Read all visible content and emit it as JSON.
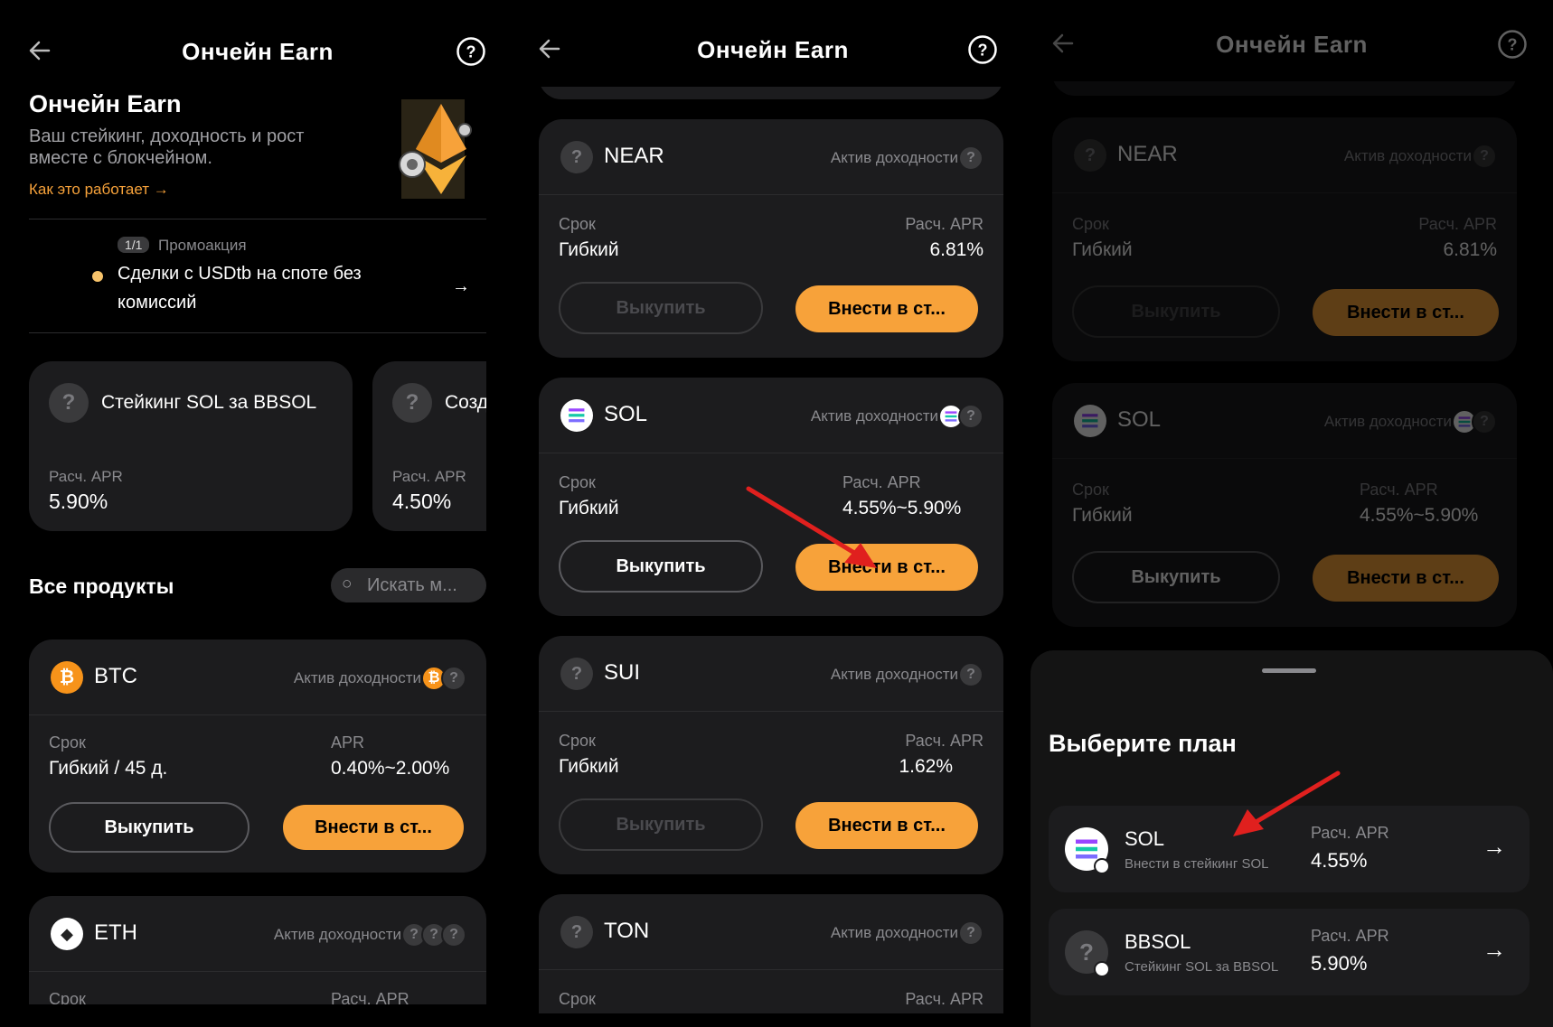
{
  "header": {
    "title": "Ончейн Earn"
  },
  "hero": {
    "title": "Ончейн Earn",
    "subtitle_line1": "Ваш стейкинг, доходность и рост",
    "subtitle_line2": "вместе с блокчейном.",
    "link": "Как это работает"
  },
  "promo": {
    "counter": "1/1",
    "tag": "Промоакция",
    "text_line1": "Сделки с USDtb на споте без",
    "text_line2": "комиссий"
  },
  "featured": [
    {
      "name": "Стейкинг SOL за BBSOL",
      "apr_label": "Расч. APR",
      "apr": "5.90%"
    },
    {
      "name": "Созд",
      "apr_label": "Расч. APR",
      "apr": "4.50%"
    }
  ],
  "all_products": {
    "title": "Все продукты",
    "search_placeholder": "Искать м..."
  },
  "common": {
    "yield_label": "Актив доходности",
    "term_label": "Срок",
    "redeem": "Выкупить",
    "deposit": "Внести в ст..."
  },
  "products_p1": [
    {
      "coin": "BTC",
      "term": "Гибкий / 45 д.",
      "apr_label": "APR",
      "apr": "0.40%~2.00%"
    },
    {
      "coin": "ETH",
      "term_label": "Срок",
      "apr_label": "Расч. APR"
    }
  ],
  "products_p2": [
    {
      "coin": "NEAR",
      "term": "Гибкий",
      "apr_label": "Расч. APR",
      "apr": "6.81%"
    },
    {
      "coin": "SOL",
      "term": "Гибкий",
      "apr_label": "Расч. APR",
      "apr": "4.55%~5.90%"
    },
    {
      "coin": "SUI",
      "term": "Гибкий",
      "apr_label": "Расч. APR",
      "apr": "1.62%"
    },
    {
      "coin": "TON",
      "apr_label": "Расч. APR"
    }
  ],
  "sheet": {
    "title": "Выберите план",
    "plans": [
      {
        "name": "SOL",
        "desc": "Внести в стейкинг SOL",
        "apr_label": "Расч. APR",
        "apr": "4.55%"
      },
      {
        "name": "BBSOL",
        "desc": "Стейкинг SOL за BBSOL",
        "apr_label": "Расч. APR",
        "apr": "5.90%"
      }
    ]
  },
  "colors": {
    "accent": "#f7a23a",
    "card": "#1c1c1e",
    "arrow": "#e0201e"
  }
}
